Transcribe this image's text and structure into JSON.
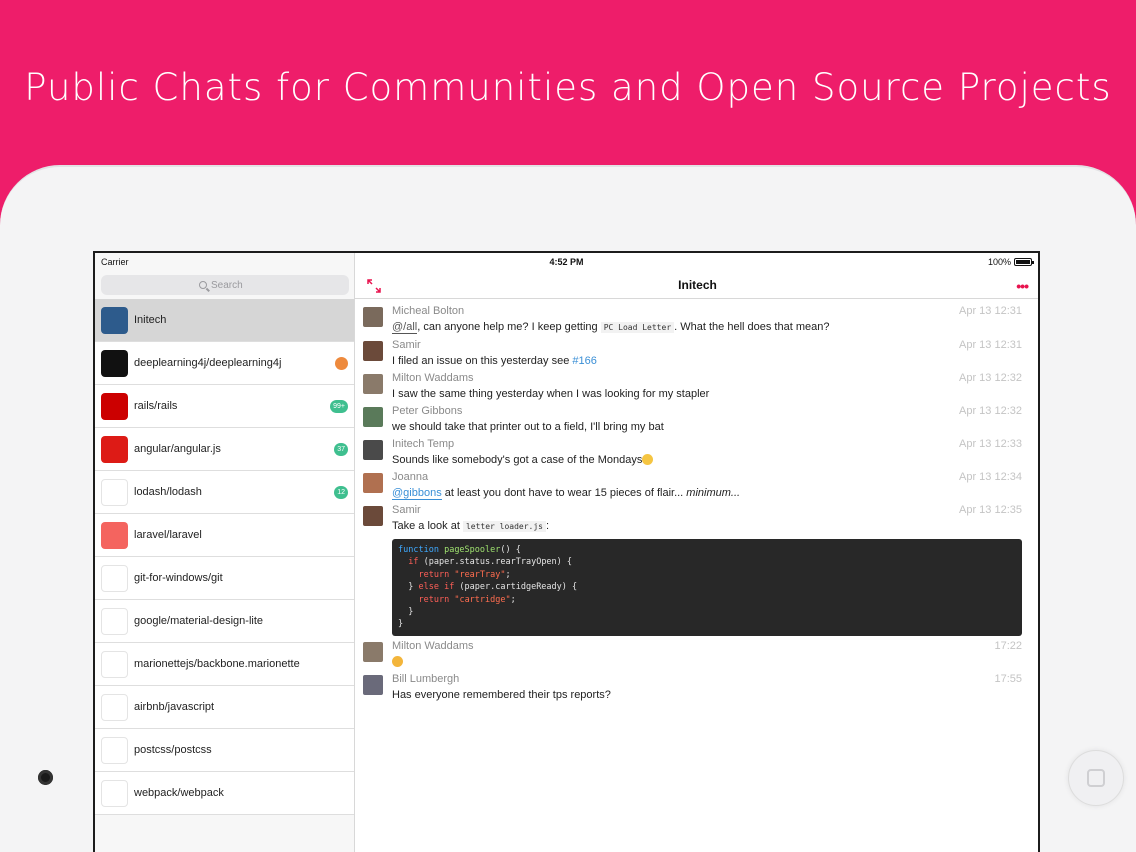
{
  "headline": "Public Chats for Communities and Open Source Projects",
  "status_bar": {
    "carrier": "Carrier",
    "time": "4:52 PM",
    "battery": "100%"
  },
  "search": {
    "placeholder": "Search"
  },
  "rooms": [
    {
      "name": "Initech",
      "badge": "",
      "icon": "initech-logo",
      "color": "#2d5b8c"
    },
    {
      "name": "deeplearning4j/deeplearning4j",
      "badge": "",
      "icon": "deeplearning4j-logo",
      "color": "#111111",
      "badge_color": "#ee8a3d"
    },
    {
      "name": "rails/rails",
      "badge": "99+",
      "icon": "rails-logo",
      "color": "#cc0000",
      "badge_color": "#3fbf8f"
    },
    {
      "name": "angular/angular.js",
      "badge": "37",
      "icon": "angular-logo",
      "color": "#dd1b16",
      "badge_color": "#3fbf8f"
    },
    {
      "name": "lodash/lodash",
      "badge": "12",
      "icon": "lodash-logo",
      "color": "#ffffff",
      "badge_color": "#3fbf8f"
    },
    {
      "name": "laravel/laravel",
      "badge": "",
      "icon": "laravel-logo",
      "color": "#f4645f"
    },
    {
      "name": "git-for-windows/git",
      "badge": "",
      "icon": "git-for-windows-logo",
      "color": "#ffffff"
    },
    {
      "name": "google/material-design-lite",
      "badge": "",
      "icon": "google-logo",
      "color": "#ffffff"
    },
    {
      "name": "marionettejs/backbone.marionette",
      "badge": "",
      "icon": "marionette-logo",
      "color": "#ffffff"
    },
    {
      "name": "airbnb/javascript",
      "badge": "",
      "icon": "airbnb-logo",
      "color": "#ffffff"
    },
    {
      "name": "postcss/postcss",
      "badge": "",
      "icon": "postcss-logo",
      "color": "#ffffff"
    },
    {
      "name": "webpack/webpack",
      "badge": "",
      "icon": "webpack-logo",
      "color": "#ffffff"
    }
  ],
  "chat": {
    "title": "Initech",
    "messages": [
      {
        "user": "Micheal Bolton",
        "time": "Apr 13 12:31",
        "avatar_color": "#7a6a5c",
        "mention": "@/all",
        "text_a": ", can anyone help me? I keep getting ",
        "code": "PC Load Letter",
        "text_b": ". What the hell does that mean?"
      },
      {
        "user": "Samir",
        "time": "Apr 13 12:31",
        "avatar_color": "#6b4a3a",
        "text": "I filed an issue on this yesterday see ",
        "link": "#166"
      },
      {
        "user": "Milton Waddams",
        "time": "Apr 13 12:32",
        "avatar_color": "#8a7a6a",
        "text": "I saw the same thing yesterday when I was looking for my stapler"
      },
      {
        "user": "Peter Gibbons",
        "time": "Apr 13 12:32",
        "avatar_color": "#5a7a5a",
        "text": "we should take that printer out to a field, I'll bring my bat"
      },
      {
        "user": "Initech Temp",
        "time": "Apr 13 12:33",
        "avatar_color": "#4a4a4a",
        "text": "Sounds like somebody's got a case of the Mondays"
      },
      {
        "user": "Joanna",
        "time": "Apr 13 12:34",
        "avatar_color": "#b07050",
        "mention": "@gibbons",
        "text": " at least you dont have to wear 15 pieces of flair... ",
        "em": "minimum..."
      },
      {
        "user": "Samir",
        "time": "Apr 13 12:35",
        "avatar_color": "#6b4a3a",
        "text": "Take a look at ",
        "code": "letter loader.js",
        "text_b": ":"
      },
      {
        "user": "Milton Waddams",
        "time": "17:22",
        "avatar_color": "#8a7a6a",
        "text": ""
      },
      {
        "user": "Bill Lumbergh",
        "time": "17:55",
        "avatar_color": "#6a6a7a",
        "text": "Has everyone remembered their tps reports?"
      }
    ],
    "code_lines": [
      {
        "parts": [
          [
            "kw2",
            "function"
          ],
          [
            "plain",
            " "
          ],
          [
            "fn",
            "pageSpooler"
          ],
          [
            "plain",
            "() {"
          ]
        ]
      },
      {
        "parts": [
          [
            "plain",
            "  "
          ],
          [
            "kw",
            "if"
          ],
          [
            "plain",
            " (paper.status.rearTrayOpen) {"
          ]
        ]
      },
      {
        "parts": [
          [
            "plain",
            "    "
          ],
          [
            "kw",
            "return"
          ],
          [
            "plain",
            " "
          ],
          [
            "str",
            "\"rearTray\""
          ],
          [
            "plain",
            ";"
          ]
        ]
      },
      {
        "parts": [
          [
            "plain",
            "  } "
          ],
          [
            "kw",
            "else if"
          ],
          [
            "plain",
            " (paper.cartidgeReady) {"
          ]
        ]
      },
      {
        "parts": [
          [
            "plain",
            "    "
          ],
          [
            "kw",
            "return"
          ],
          [
            "plain",
            " "
          ],
          [
            "str",
            "\"cartridge\""
          ],
          [
            "plain",
            ";"
          ]
        ]
      },
      {
        "parts": [
          [
            "plain",
            "  }"
          ]
        ]
      },
      {
        "parts": [
          [
            "plain",
            "}"
          ]
        ]
      }
    ]
  },
  "colors": {
    "brand": "#ee1d6a",
    "accent": "#e8134f",
    "link": "#3a8fd6"
  }
}
